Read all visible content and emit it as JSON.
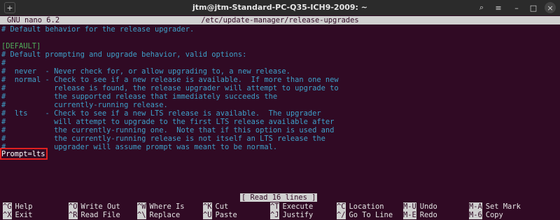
{
  "window": {
    "title": "jtm@jtm-Standard-PC-Q35-ICH9-2009: ~"
  },
  "header": {
    "version": "GNU nano 6.2",
    "file": "/etc/update-manager/release-upgrades"
  },
  "lines": [
    "# Default behavior for the release upgrader.",
    "",
    "[DEFAULT]",
    "# Default prompting and upgrade behavior, valid options:",
    "#",
    "#  never  - Never check for, or allow upgrading to, a new release.",
    "#  normal - Check to see if a new release is available.  If more than one new",
    "#           release is found, the release upgrader will attempt to upgrade to",
    "#           the supported release that immediately succeeds the",
    "#           currently-running release.",
    "#  lts    - Check to see if a new LTS release is available.  The upgrader",
    "#           will attempt to upgrade to the first LTS release available after",
    "#           the currently-running one.  Note that if this option is used and",
    "#           the currently-running release is not itself an LTS release the",
    "#           upgrader will assume prompt was meant to be normal."
  ],
  "prompt_line": "Prompt=lts",
  "status": "[ Read 16 lines ]",
  "shortcuts_row1": [
    {
      "key": "^G",
      "label": "Help"
    },
    {
      "key": "^O",
      "label": "Write Out"
    },
    {
      "key": "^W",
      "label": "Where Is"
    },
    {
      "key": "^K",
      "label": "Cut"
    },
    {
      "key": "^T",
      "label": "Execute"
    },
    {
      "key": "^C",
      "label": "Location"
    },
    {
      "key": "M-U",
      "label": "Undo"
    },
    {
      "key": "M-A",
      "label": "Set Mark"
    }
  ],
  "shortcuts_row2": [
    {
      "key": "^X",
      "label": "Exit"
    },
    {
      "key": "^R",
      "label": "Read File"
    },
    {
      "key": "^\\",
      "label": "Replace"
    },
    {
      "key": "^U",
      "label": "Paste"
    },
    {
      "key": "^J",
      "label": "Justify"
    },
    {
      "key": "^/",
      "label": "Go To Line"
    },
    {
      "key": "M-E",
      "label": "Redo"
    },
    {
      "key": "M-6",
      "label": "Copy"
    }
  ],
  "icons": {
    "new_tab": "+",
    "search": "⌕",
    "menu": "≡",
    "minimize": "–",
    "maximize": "□",
    "close": "×"
  },
  "colors": {
    "terminal_bg": "#300a24",
    "comment": "#3ea0c9",
    "section": "#4fae5a",
    "highlight_box": "#e02020"
  }
}
